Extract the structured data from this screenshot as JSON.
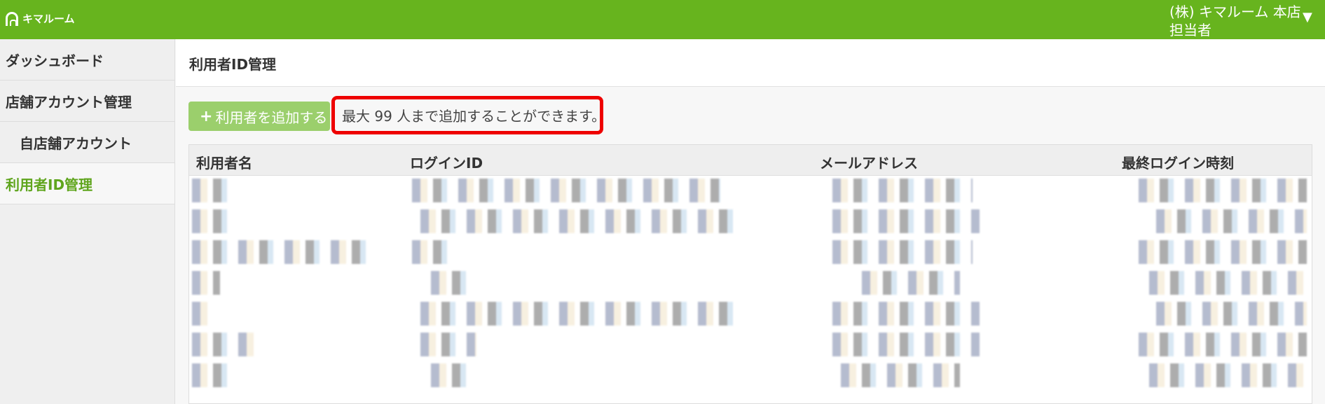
{
  "topbar": {
    "logo_text": "キマルーム",
    "user_shop": "(株) キマルーム 本店",
    "user_role": "担当者",
    "caret": "▼"
  },
  "sidebar": {
    "items": [
      {
        "label": "ダッシュボード"
      },
      {
        "label": "店舗アカウント管理"
      },
      {
        "label": "自店舗アカウント"
      },
      {
        "label": "利用者ID管理"
      }
    ]
  },
  "main": {
    "page_title": "利用者ID管理",
    "add_button_label": "利用者を追加する",
    "add_button_icon": "+",
    "notice_text": "最大 99 人まで追加することができます。"
  },
  "table": {
    "columns": [
      "利用者名",
      "ログインID",
      "メールアドレス",
      "最終ログイン時刻"
    ]
  },
  "colors": {
    "header_green": "#67b41e",
    "active_green": "#5fa51d",
    "button_green": "#9bcf6c",
    "notice_border": "#ee0000"
  }
}
